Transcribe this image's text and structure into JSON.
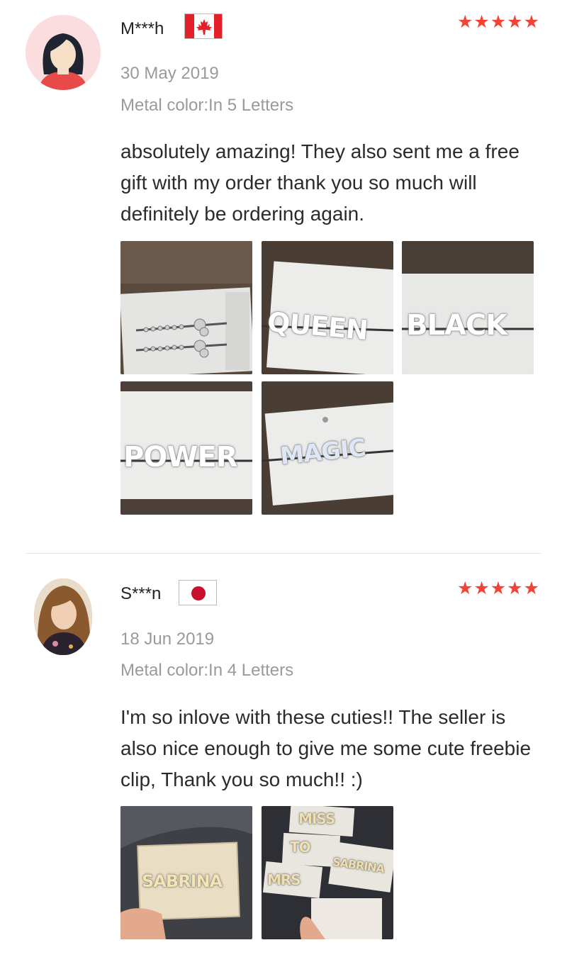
{
  "reviews": [
    {
      "reviewer": "M***h",
      "country": "Canada",
      "rating": 5,
      "stars": "★★★★★",
      "date": "30 May 2019",
      "variant": "Metal color:In 5 Letters",
      "text": "absolutely amazing! They also sent me a free gift with my order thank you so much will definitely be ordering again.",
      "photos": [
        {
          "name": "photo-hairpins"
        },
        {
          "name": "photo-queen",
          "label": "QUEEN"
        },
        {
          "name": "photo-black",
          "label": "BLACK"
        },
        {
          "name": "photo-power",
          "label": "POWER"
        },
        {
          "name": "photo-magic",
          "label": "MAGIC"
        }
      ]
    },
    {
      "reviewer": "S***n",
      "country": "Japan",
      "rating": 5,
      "stars": "★★★★★",
      "date": "18 Jun 2019",
      "variant": "Metal color:In 4 Letters",
      "text": "I'm so inlove with these cuties!! The seller is also nice enough to give me some cute freebie clip, Thank you so much!! :)",
      "photos": [
        {
          "name": "photo-sabrina",
          "label": "SABRINA"
        },
        {
          "name": "photo-miss-to-mrs",
          "labels": [
            "MISS",
            "TO",
            "MRS",
            "SABRINA"
          ]
        }
      ]
    }
  ],
  "colors": {
    "star": "#f44336",
    "muted_text": "#9a9a9a",
    "divider": "#e6e6e6",
    "canada_red": "#e4202a",
    "japan_red": "#c8102e"
  },
  "icons": {
    "avatar_1": "female-avatar-icon",
    "avatar_2": "user-photo-avatar",
    "flag_1": "canada-flag-icon",
    "flag_2": "japan-flag-icon",
    "rating": "star-icon"
  }
}
